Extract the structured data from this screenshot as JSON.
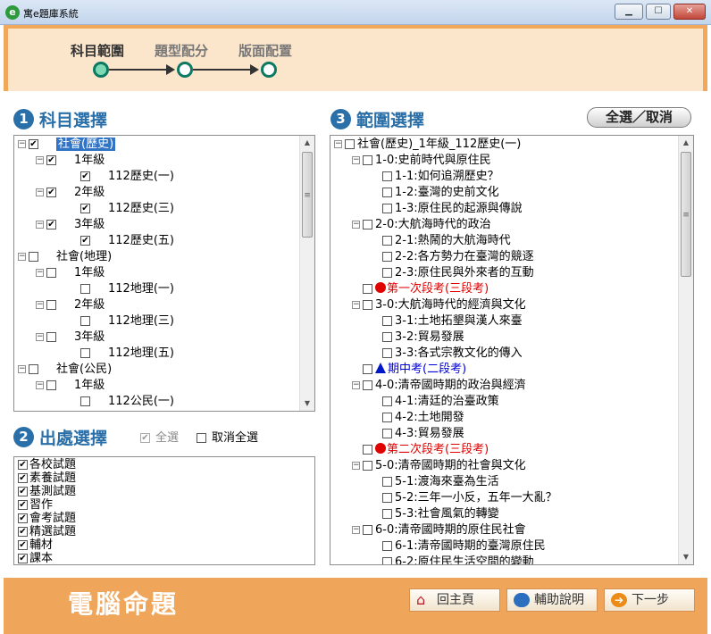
{
  "window": {
    "title": "寓e題庫系統",
    "app_icon": "e",
    "min": "▁",
    "max": "☐",
    "close": "✕"
  },
  "steps": [
    {
      "label": "科目範圍",
      "state": "active"
    },
    {
      "label": "題型配分",
      "state": "inactive"
    },
    {
      "label": "版面配置",
      "state": "inactive"
    }
  ],
  "section1": {
    "num": "1",
    "title": "科目選擇"
  },
  "section2": {
    "num": "2",
    "title": "出處選擇",
    "select_all": "全選",
    "cancel_all": "取消全選"
  },
  "section3": {
    "num": "3",
    "title": "範圍選擇",
    "toggle_button": "全選／取消"
  },
  "subject_tree": [
    {
      "label": "社會(歷史)",
      "level": 0,
      "checked": true,
      "selected": true,
      "expander": "⊟"
    },
    {
      "label": "1年級",
      "level": 1,
      "checked": true,
      "expander": "⊟"
    },
    {
      "label": "112歷史(一)",
      "level": 2,
      "checked": true
    },
    {
      "label": "2年級",
      "level": 1,
      "checked": true,
      "expander": "⊟"
    },
    {
      "label": "112歷史(三)",
      "level": 2,
      "checked": true
    },
    {
      "label": "3年級",
      "level": 1,
      "checked": true,
      "expander": "⊟"
    },
    {
      "label": "112歷史(五)",
      "level": 2,
      "checked": true
    },
    {
      "label": "社會(地理)",
      "level": 0,
      "checked": false,
      "expander": "⊟"
    },
    {
      "label": "1年級",
      "level": 1,
      "checked": false,
      "expander": "⊟"
    },
    {
      "label": "112地理(一)",
      "level": 2,
      "checked": false
    },
    {
      "label": "2年級",
      "level": 1,
      "checked": false,
      "expander": "⊟"
    },
    {
      "label": "112地理(三)",
      "level": 2,
      "checked": false
    },
    {
      "label": "3年級",
      "level": 1,
      "checked": false,
      "expander": "⊟"
    },
    {
      "label": "112地理(五)",
      "level": 2,
      "checked": false
    },
    {
      "label": "社會(公民)",
      "level": 0,
      "checked": false,
      "expander": "⊟"
    },
    {
      "label": "1年級",
      "level": 1,
      "checked": false,
      "expander": "⊟"
    },
    {
      "label": "112公民(一)",
      "level": 2,
      "checked": false
    }
  ],
  "sources": [
    {
      "label": "各校試題",
      "checked": true
    },
    {
      "label": "素養試題",
      "checked": true
    },
    {
      "label": "基測試題",
      "checked": true
    },
    {
      "label": "習作",
      "checked": true
    },
    {
      "label": "會考試題",
      "checked": true
    },
    {
      "label": "精選試題",
      "checked": true
    },
    {
      "label": "輔材",
      "checked": true
    },
    {
      "label": "課本",
      "checked": true
    }
  ],
  "range_tree": [
    {
      "label": "社會(歷史)_1年級_112歷史(一)",
      "level": 0,
      "expander": "⊟"
    },
    {
      "label": "1-0:史前時代與原住民",
      "level": 1,
      "expander": "⊟"
    },
    {
      "label": "1-1:如何追溯歷史？",
      "level": 2
    },
    {
      "label": "1-2:臺灣的史前文化",
      "level": 2
    },
    {
      "label": "1-3:原住民的起源與傳說",
      "level": 2
    },
    {
      "label": "2-0:大航海時代的政治",
      "level": 1,
      "expander": "⊟"
    },
    {
      "label": "2-1:熱鬧的大航海時代",
      "level": 2
    },
    {
      "label": "2-2:各方勢力在臺灣的競逐",
      "level": 2
    },
    {
      "label": "2-3:原住民與外來者的互動",
      "level": 2
    },
    {
      "label": "第一次段考(三段考)",
      "level": 1,
      "marker": "red-dot"
    },
    {
      "label": "3-0:大航海時代的經濟與文化",
      "level": 1,
      "expander": "⊟"
    },
    {
      "label": "3-1:土地拓墾與漢人來臺",
      "level": 2
    },
    {
      "label": "3-2:貿易發展",
      "level": 2
    },
    {
      "label": "3-3:各式宗教文化的傳入",
      "level": 2
    },
    {
      "label": "期中考(二段考)",
      "level": 1,
      "marker": "blue-triangle"
    },
    {
      "label": "4-0:清帝國時期的政治與經濟",
      "level": 1,
      "expander": "⊟"
    },
    {
      "label": "4-1:清廷的治臺政策",
      "level": 2
    },
    {
      "label": "4-2:土地開發",
      "level": 2
    },
    {
      "label": "4-3:貿易發展",
      "level": 2
    },
    {
      "label": "第二次段考(三段考)",
      "level": 1,
      "marker": "red-dot"
    },
    {
      "label": "5-0:清帝國時期的社會與文化",
      "level": 1,
      "expander": "⊟"
    },
    {
      "label": "5-1:渡海來臺為生活",
      "level": 2
    },
    {
      "label": "5-2:三年一小反，五年一大亂？",
      "level": 2
    },
    {
      "label": "5-3:社會風氣的轉變",
      "level": 2
    },
    {
      "label": "6-0:清帝國時期的原住民社會",
      "level": 1,
      "expander": "⊟"
    },
    {
      "label": "6-1:清帝國時期的臺灣原住民",
      "level": 2
    },
    {
      "label": "6-2:原住民生活空間的變動",
      "level": 2
    }
  ],
  "footer": {
    "title": "電腦命題",
    "home": "回主頁",
    "help": "輔助說明",
    "next": "下一步"
  },
  "colors": {
    "accent": "#2a6fa8",
    "orange": "#f0a65a",
    "header_bg": "#fce6cb",
    "step_green": "#0c7a63"
  }
}
